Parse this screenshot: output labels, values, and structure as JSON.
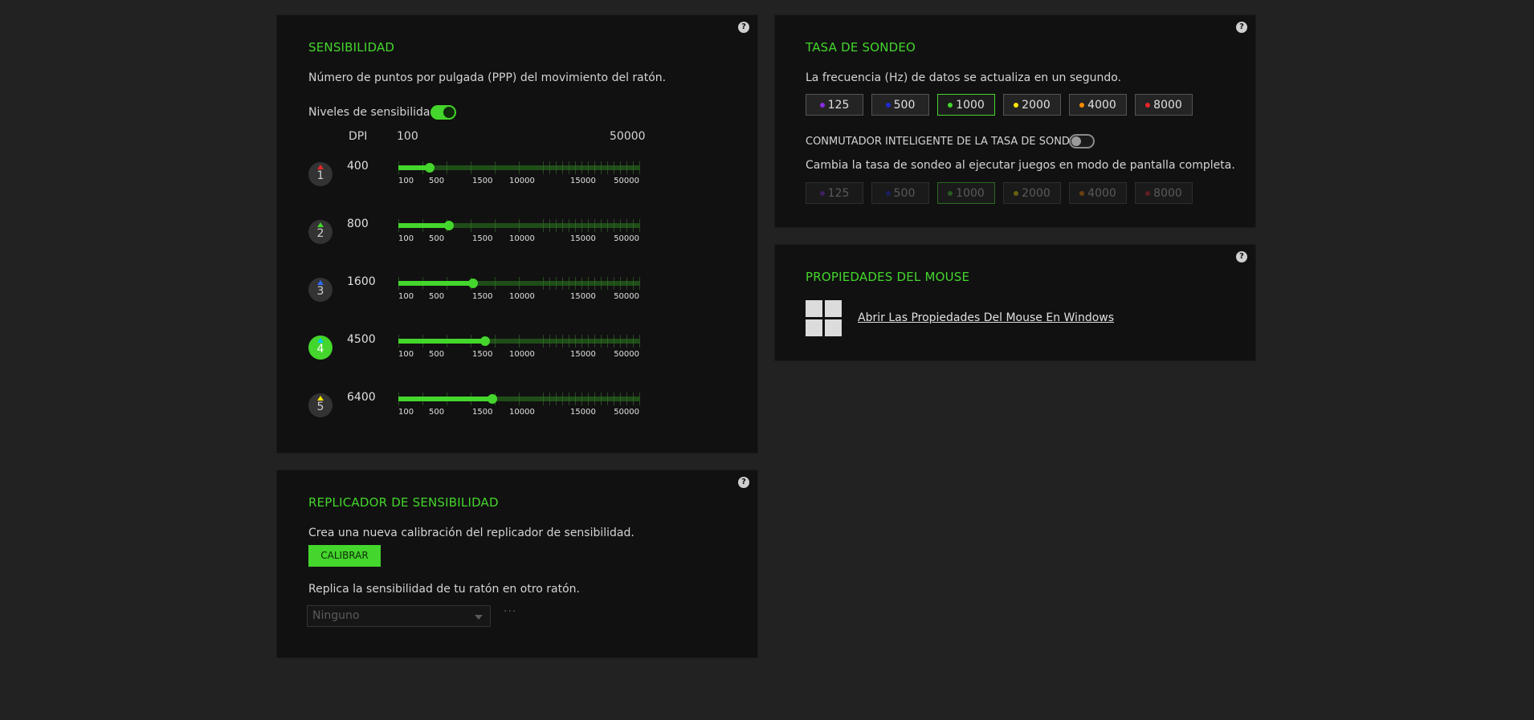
{
  "sensitivity": {
    "title": "SENSIBILIDAD",
    "description": "Número de puntos por pulgada (PPP) del movimiento del ratón.",
    "levels_label": "Niveles de sensibilidad",
    "levels_enabled": true,
    "header_dpi": "DPI",
    "header_min": "100",
    "header_max": "50000",
    "tick_labels": [
      "100",
      "500",
      "1500",
      "10000",
      "15000",
      "50000"
    ],
    "stages": [
      {
        "number": "1",
        "value": "400",
        "indicator_color": "#e8262a",
        "active": false,
        "slider_fraction": 0.13
      },
      {
        "number": "2",
        "value": "800",
        "indicator_color": "#44d62c",
        "active": false,
        "slider_fraction": 0.21
      },
      {
        "number": "3",
        "value": "1600",
        "indicator_color": "#2f6bff",
        "active": false,
        "slider_fraction": 0.31
      },
      {
        "number": "4",
        "value": "4500",
        "indicator_color": "#00c8ff",
        "active": true,
        "slider_fraction": 0.36
      },
      {
        "number": "5",
        "value": "6400",
        "indicator_color": "#ffe600",
        "active": false,
        "slider_fraction": 0.39
      }
    ]
  },
  "polling": {
    "title": "TASA DE SONDEO",
    "description": "La frecuencia (Hz) de datos se actualiza en un segundo.",
    "rates": [
      {
        "label": "125",
        "color": "#8a2be2"
      },
      {
        "label": "500",
        "color": "#1e2bd6"
      },
      {
        "label": "1000",
        "color": "#44d62c"
      },
      {
        "label": "2000",
        "color": "#ffe600"
      },
      {
        "label": "4000",
        "color": "#ff8a00"
      },
      {
        "label": "8000",
        "color": "#e8262a"
      }
    ],
    "selected": "1000",
    "smart_label": "CONMUTADOR INTELIGENTE DE LA TASA DE SONDEO",
    "smart_enabled": false,
    "smart_description": "Cambia la tasa de sondeo al ejecutar juegos en modo de pantalla completa.",
    "smart_selected": "1000"
  },
  "mouse_properties": {
    "title": "PROPIEDADES DEL MOUSE",
    "link": "Abrir Las Propiedades Del Mouse En Windows"
  },
  "replicator": {
    "title": "REPLICADOR DE SENSIBILIDAD",
    "description": "Crea una nueva calibración del replicador de sensibilidad.",
    "calibrate_label": "CALIBRAR",
    "replicate_text": "Replica la sensibilidad de tu ratón en otro ratón.",
    "select_value": "Ninguno",
    "more_label": "···"
  },
  "help_label": "?"
}
